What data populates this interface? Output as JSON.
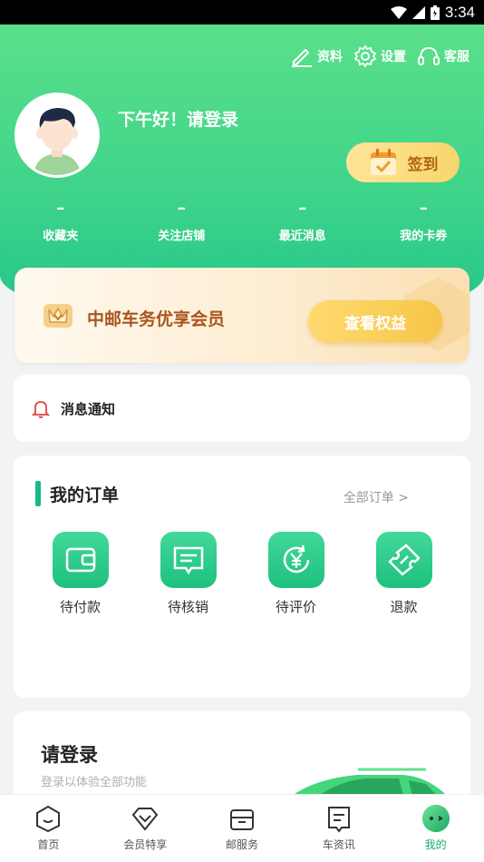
{
  "status_bar": {
    "time": "3:34"
  },
  "header": {
    "actions": [
      {
        "label": "资料",
        "icon": "edit-icon"
      },
      {
        "label": "设置",
        "icon": "gear-icon"
      },
      {
        "label": "客服",
        "icon": "headset-icon"
      }
    ],
    "greeting": "下午好！请登录",
    "checkin_label": "签到",
    "stats": [
      {
        "value": "–",
        "label": "收藏夹"
      },
      {
        "value": "–",
        "label": "关注店铺"
      },
      {
        "value": "–",
        "label": "最近消息"
      },
      {
        "value": "–",
        "label": "我的卡券"
      }
    ]
  },
  "member": {
    "title": "中邮车务优享会员",
    "button": "查看权益"
  },
  "notice": {
    "label": "消息通知"
  },
  "orders": {
    "title": "我的订单",
    "all_label": "全部订单 >",
    "items": [
      {
        "label": "待付款",
        "icon": "wallet-icon"
      },
      {
        "label": "待核销",
        "icon": "message-box-icon"
      },
      {
        "label": "待评价",
        "icon": "yen-refresh-icon"
      },
      {
        "label": "退款",
        "icon": "ticket-icon"
      }
    ]
  },
  "login_card": {
    "title": "请登录",
    "subtitle": "登录以体验全部功能"
  },
  "bottom_nav": [
    {
      "label": "首页",
      "icon": "home-icon",
      "active": false
    },
    {
      "label": "会员特享",
      "icon": "diamond-icon",
      "active": false
    },
    {
      "label": "邮服务",
      "icon": "package-icon",
      "active": false
    },
    {
      "label": "车资讯",
      "icon": "news-icon",
      "active": false
    },
    {
      "label": "我的",
      "icon": "profile-icon",
      "active": true
    }
  ],
  "colors": {
    "primary_green": "#3fd48a",
    "accent_gold": "#f6c648",
    "member_text": "#a9561e"
  }
}
